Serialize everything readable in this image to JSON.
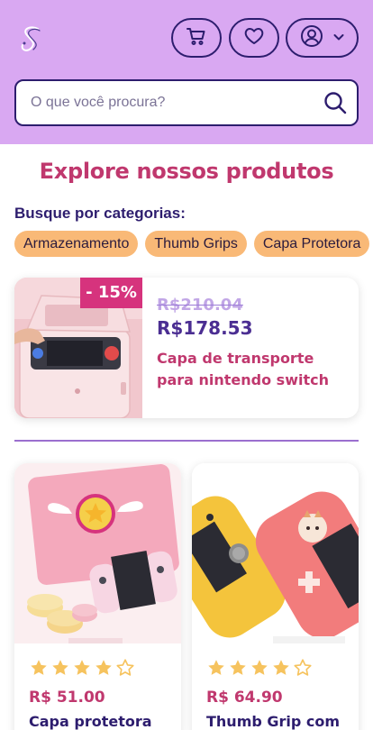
{
  "header": {
    "logo_icon": "stylized-s-logo",
    "cart_icon": "cart-icon",
    "favorites_icon": "heart-icon",
    "account_icon": "user-circle-icon",
    "account_chevron": "chevron-down-icon"
  },
  "search": {
    "placeholder": "O que você procura?",
    "value": "",
    "icon": "search-icon"
  },
  "main": {
    "title": "Explore nossos produtos",
    "categories_label": "Busque por categorias:",
    "categories": [
      "Armazenamento",
      "Thumb Grips",
      "Capa Protetora"
    ]
  },
  "featured": {
    "discount": "- 15%",
    "old_price": "R$210.04",
    "new_price": "R$178.53",
    "name": "Capa de transporte para nintendo switch"
  },
  "products": [
    {
      "price": "R$ 51.00",
      "name": "Capa protetora",
      "rating": 4
    },
    {
      "price": "R$ 64.90",
      "name": "Thumb Grip com",
      "rating": 4
    }
  ],
  "colors": {
    "header_bg": "#d9a8f2",
    "primary_dark": "#2d1d6e",
    "accent_pink": "#c0386e",
    "chip_bg": "#f9b977",
    "discount_bg": "#d6337d",
    "star": "#f6c35e"
  }
}
